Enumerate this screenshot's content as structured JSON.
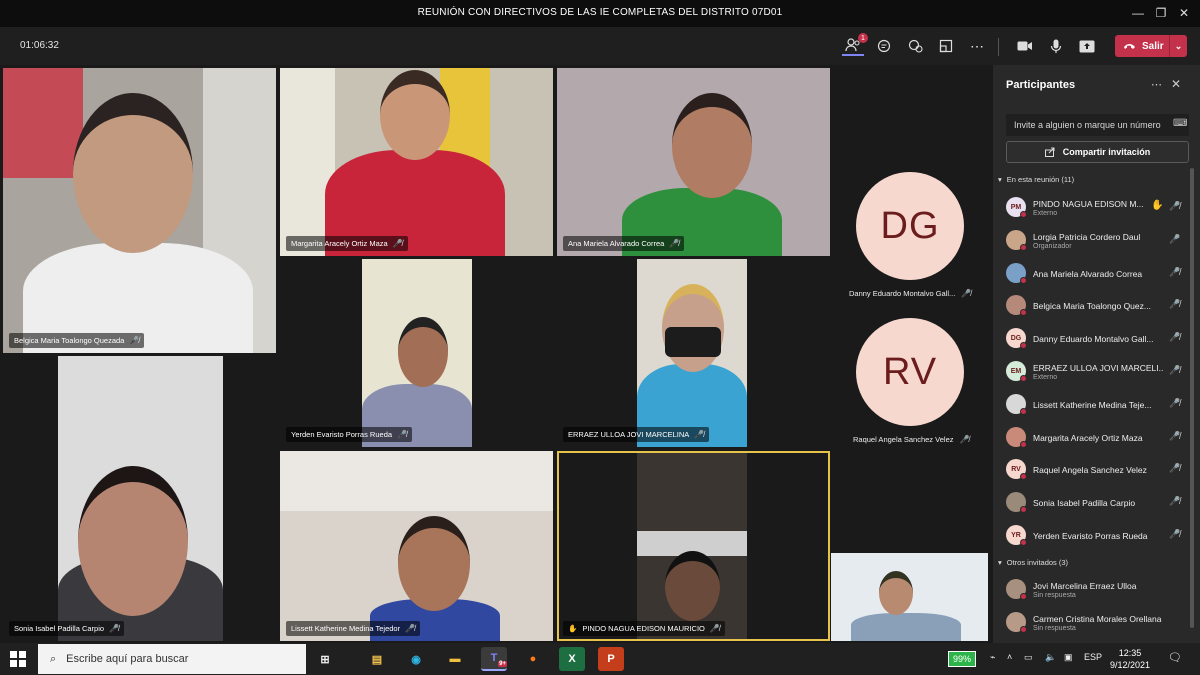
{
  "window": {
    "title": "REUNIÓN CON DIRECTIVOS DE LAS IE COMPLETAS DEL DISTRITO 07D01",
    "minimize": "—",
    "maximize": "❐",
    "close": "✕"
  },
  "toolbar": {
    "timer": "01:06:32",
    "participants_badge": "1",
    "leave_label": "Salir"
  },
  "tiles": [
    {
      "name": "Belgica Maria Toalongo Quezada"
    },
    {
      "name": "Margarita Aracely Ortiz Maza"
    },
    {
      "name": "Ana Mariela Alvarado Correa"
    },
    {
      "name": "Yerden Evaristo Porras Rueda"
    },
    {
      "name": "ERRAEZ ULLOA JOVI MARCELINA"
    },
    {
      "name": "Sonia Isabel Padilla Carpio"
    },
    {
      "name": "Lissett Katherine Medina Tejedor"
    },
    {
      "name": "PINDO NAGUA EDISON MAURICIO"
    }
  ],
  "avatars": [
    {
      "initials": "DG",
      "name": "Danny Eduardo Montalvo Gall..."
    },
    {
      "initials": "RV",
      "name": "Raquel Angela Sanchez Velez"
    }
  ],
  "panel": {
    "title": "Participantes",
    "invite_placeholder": "Invite a alguien o marque un número",
    "share_label": "Compartir invitación",
    "in_meeting_header": "En esta reunión (11)",
    "invited_header": "Otros invitados (3)",
    "in_meeting": [
      {
        "initials": "PM",
        "name": "PINDO NAGUA EDISON M...",
        "role": "Externo",
        "color": "#e8e0f0"
      },
      {
        "initials": "",
        "name": "Lorgia Patricia Cordero Daul",
        "role": "Organizador",
        "color": "#c9a58a"
      },
      {
        "initials": "",
        "name": "Ana Mariela Alvarado Correa",
        "role": "",
        "color": "#7aa0c8"
      },
      {
        "initials": "",
        "name": "Belgica Maria Toalongo Quez...",
        "role": "",
        "color": "#b58a7a"
      },
      {
        "initials": "DG",
        "name": "Danny Eduardo Montalvo Gall...",
        "role": "",
        "color": "#f6d8cf"
      },
      {
        "initials": "EM",
        "name": "ERRAEZ ULLOA JOVI MARCELI...",
        "role": "Externo",
        "color": "#d4ecd9"
      },
      {
        "initials": "",
        "name": "Lissett Katherine Medina Teje...",
        "role": "",
        "color": "#d8d8d8"
      },
      {
        "initials": "",
        "name": "Margarita Aracely Ortiz Maza",
        "role": "",
        "color": "#c98a7a"
      },
      {
        "initials": "RV",
        "name": "Raquel Angela Sanchez Velez",
        "role": "",
        "color": "#f6d8cf"
      },
      {
        "initials": "",
        "name": "Sonia Isabel Padilla Carpio",
        "role": "",
        "color": "#9a8a7a"
      },
      {
        "initials": "YR",
        "name": "Yerden Evaristo Porras Rueda",
        "role": "",
        "color": "#f6d8cf"
      }
    ],
    "invited": [
      {
        "name": "Jovi Marcelina Erraez Ulloa",
        "role": "Sin respuesta",
        "color": "#a89080"
      },
      {
        "name": "Carmen Cristina Morales Orellana",
        "role": "Sin respuesta",
        "color": "#b89a88"
      }
    ]
  },
  "taskbar": {
    "search_placeholder": "Escribe aquí para buscar",
    "teams_badge": "9+",
    "battery": "99%",
    "language": "ESP",
    "time": "12:35",
    "date": "9/12/2021"
  }
}
